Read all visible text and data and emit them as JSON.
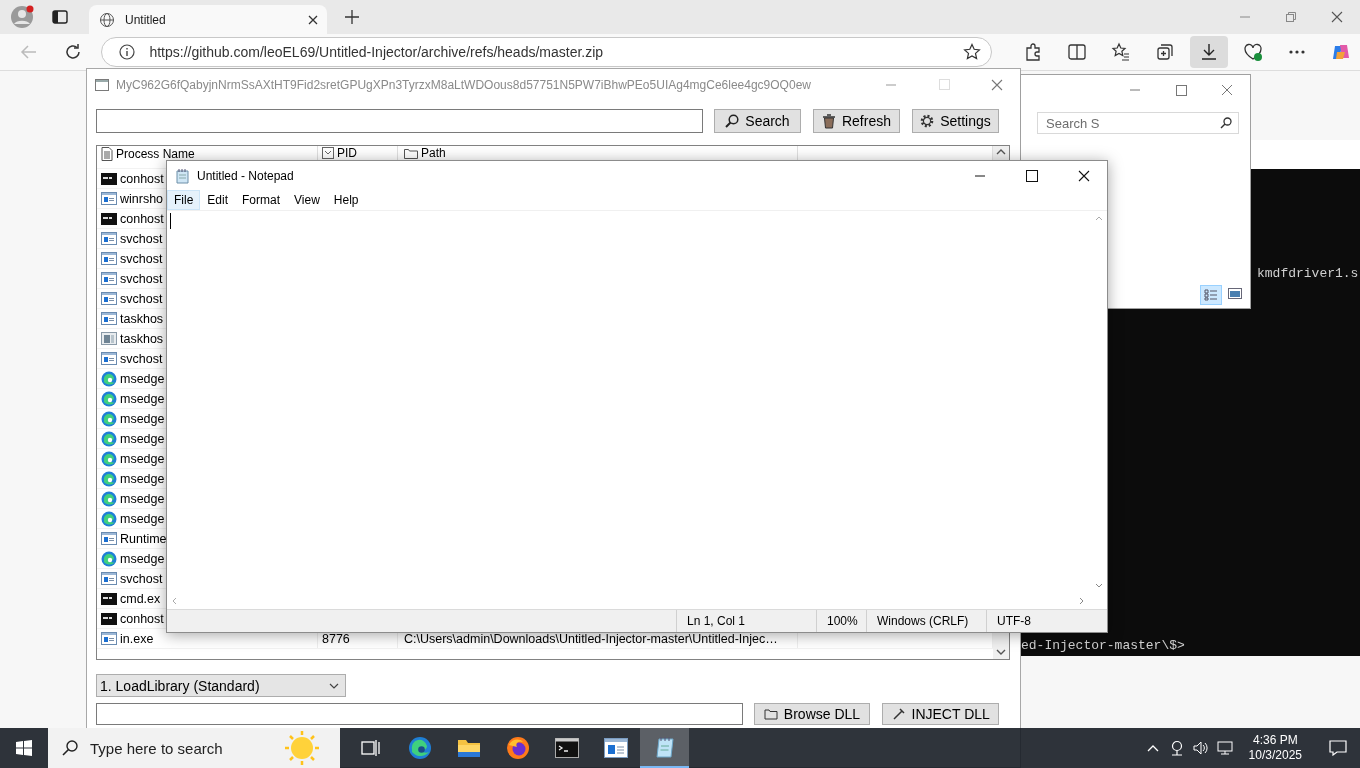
{
  "browser": {
    "tab_title": "Untitled",
    "address": "https://github.com/leoEL69/Untitled-Injector/archive/refs/heads/master.zip"
  },
  "injector": {
    "title": "MyC962G6fQabyjnNrmSsAXtHT9Fid2sretGPUgXPn3TyrzxM8aLtWDOous8d57751N5PW7iBhwPEo5UIAg4mgCe6lee4gc9OQ0ew",
    "buttons": [
      {
        "kind": "search",
        "label": "Search"
      },
      {
        "kind": "refresh",
        "label": "Refresh"
      },
      {
        "kind": "settings",
        "label": "Settings"
      }
    ],
    "columns": [
      "Process Name",
      "PID",
      "Path"
    ],
    "rows": [
      {
        "kind": "console",
        "name": "conhost"
      },
      {
        "kind": "app",
        "name": "winrsho"
      },
      {
        "kind": "console",
        "name": "conhost"
      },
      {
        "kind": "app",
        "name": "svchost"
      },
      {
        "kind": "app",
        "name": "svchost"
      },
      {
        "kind": "app",
        "name": "svchost"
      },
      {
        "kind": "app",
        "name": "svchost"
      },
      {
        "kind": "app",
        "name": "taskhos"
      },
      {
        "kind": "app-grey",
        "name": "taskhos"
      },
      {
        "kind": "app",
        "name": "svchost"
      },
      {
        "kind": "edge",
        "name": "msedge"
      },
      {
        "kind": "edge",
        "name": "msedge"
      },
      {
        "kind": "edge",
        "name": "msedge"
      },
      {
        "kind": "edge",
        "name": "msedge"
      },
      {
        "kind": "edge",
        "name": "msedge"
      },
      {
        "kind": "edge",
        "name": "msedge"
      },
      {
        "kind": "edge",
        "name": "msedge"
      },
      {
        "kind": "edge",
        "name": "msedge"
      },
      {
        "kind": "app",
        "name": "Runtime"
      },
      {
        "kind": "edge",
        "name": "msedge"
      },
      {
        "kind": "app",
        "name": "svchost"
      },
      {
        "kind": "console",
        "name": "cmd.ex"
      },
      {
        "kind": "console",
        "name": "conhost"
      },
      {
        "kind": "app",
        "name": "in.exe",
        "pid": "8776",
        "path": "C:\\Users\\admin\\Downloads\\Untitled-Injector-master\\Untitled-Injec…"
      }
    ],
    "method": "1. LoadLibrary (Standard)",
    "bottom_buttons": [
      {
        "kind": "browse",
        "label": "Browse DLL"
      },
      {
        "kind": "inject",
        "label": "INJECT DLL"
      }
    ]
  },
  "console": {
    "lines": [
      "kmdfdriver1.s",
      "ed-Injector-master\\$>"
    ]
  },
  "explorer": {
    "search_placeholder": "Search S"
  },
  "notepad": {
    "title": "Untitled - Notepad",
    "menu": [
      {
        "label": "File",
        "selected": true
      },
      {
        "label": "Edit",
        "selected": false
      },
      {
        "label": "Format",
        "selected": false
      },
      {
        "label": "View",
        "selected": false
      },
      {
        "label": "Help",
        "selected": false
      }
    ],
    "status": [
      "Ln 1, Col 1",
      "100%",
      "Windows (CRLF)",
      "UTF-8"
    ]
  },
  "taskbar": {
    "search_placeholder": "Type here to search",
    "apps": [
      {
        "kind": "taskview",
        "selected": false
      },
      {
        "kind": "edge",
        "selected": false
      },
      {
        "kind": "folder",
        "selected": false
      },
      {
        "kind": "firefox",
        "selected": false
      },
      {
        "kind": "terminal",
        "selected": false
      },
      {
        "kind": "window",
        "selected": false
      },
      {
        "kind": "notepad",
        "selected": true
      }
    ],
    "time": "4:36 PM",
    "date": "10/3/2025"
  }
}
